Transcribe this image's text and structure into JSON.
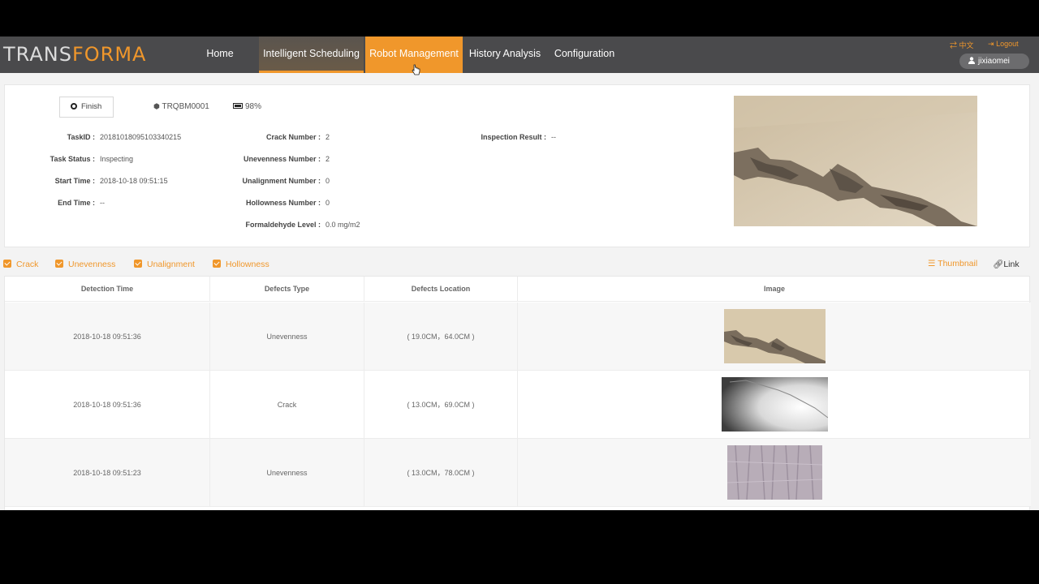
{
  "brand": {
    "logo_part1": "TRANS",
    "logo_part2": "FORMA"
  },
  "nav": {
    "items": [
      {
        "label": "Home"
      },
      {
        "label": "Intelligent Scheduling"
      },
      {
        "label": "Robot Management"
      },
      {
        "label": "History Analysis"
      },
      {
        "label": "Configuration"
      }
    ],
    "language_label": "中文",
    "logout_label": "Logout",
    "username": "jixiaomei"
  },
  "task": {
    "finish_label": "Finish",
    "robot_id": "TRQBM0001",
    "battery": "98%",
    "fields_left": [
      {
        "label": "TaskID :",
        "value": "20181018095103340215"
      },
      {
        "label": "Task Status :",
        "value": "Inspecting"
      },
      {
        "label": "Start Time :",
        "value": "2018-10-18 09:51:15"
      },
      {
        "label": "End Time :",
        "value": "--"
      }
    ],
    "fields_mid": [
      {
        "label": "Crack Number :",
        "value": "2"
      },
      {
        "label": "Unevenness Number :",
        "value": "2"
      },
      {
        "label": "Unalignment Number :",
        "value": "0"
      },
      {
        "label": "Hollowness Number :",
        "value": "0"
      },
      {
        "label": "Formaldehyde Level :",
        "value": "0.0 mg/m2"
      }
    ],
    "fields_right": [
      {
        "label": "Inspection Result :",
        "value": "--"
      }
    ]
  },
  "filters": [
    {
      "label": "Crack",
      "checked": true
    },
    {
      "label": "Unevenness",
      "checked": true
    },
    {
      "label": "Unalignment",
      "checked": true
    },
    {
      "label": "Hollowness",
      "checked": true
    }
  ],
  "view_modes": {
    "thumbnail": "Thumbnail",
    "link": "Link"
  },
  "table": {
    "columns": [
      "Detection Time",
      "Defects Type",
      "Defects Location",
      "Image"
    ],
    "rows": [
      {
        "time": "2018-10-18 09:51:36",
        "type": "Unevenness",
        "location": "( 19.0CM，64.0CM )",
        "image": "peeling-wall-thumbnail"
      },
      {
        "time": "2018-10-18 09:51:36",
        "type": "Crack",
        "location": "( 13.0CM，69.0CM )",
        "image": "cracked-wall-thumbnail"
      },
      {
        "time": "2018-10-18 09:51:23",
        "type": "Unevenness",
        "location": "( 13.0CM，78.0CM )",
        "image": "textured-wall-thumbnail"
      }
    ]
  },
  "colors": {
    "accent": "#f0972b",
    "nav_bg": "#4a4a4c"
  }
}
